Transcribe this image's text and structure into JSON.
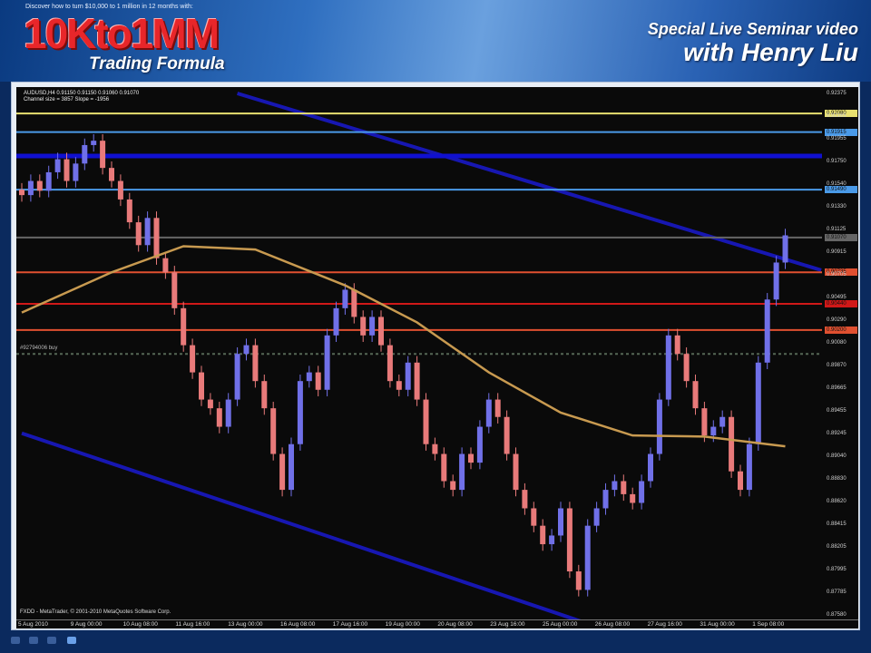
{
  "banner": {
    "tagline": "Discover how to turn $10,000 to 1 million in 12 months with:",
    "logo": "10Kto1MM",
    "logo_sub": "Trading Formula",
    "seminar_line1": "Special Live Seminar video",
    "seminar_line2": "with Henry Liu"
  },
  "chart_info": {
    "symbol_line": "AUDUSD,H4  0.91150 0.91150 0.91060 0.91070",
    "channel_line": "Channel size = 3857  Slope = -1956",
    "order_label": "#92794006 buy",
    "copyright": "FXDD - MetaTrader, © 2001-2010 MetaQuotes Software Corp."
  },
  "colors": {
    "bull": "#7070e8",
    "bear": "#e87a7a",
    "ma": "#c89a50",
    "channel": "#1a1ad0",
    "background": "#0a0a0a"
  },
  "chart_data": {
    "type": "candlestick",
    "title": "AUDUSD,H4",
    "ylim": [
      0.8758,
      0.92375
    ],
    "y_ticks": [
      "0.92375",
      "0.92165",
      "0.91955",
      "0.91750",
      "0.91540",
      "0.91330",
      "0.91125",
      "0.90915",
      "0.90705",
      "0.90495",
      "0.90290",
      "0.90080",
      "0.89870",
      "0.89665",
      "0.89455",
      "0.89245",
      "0.89040",
      "0.88830",
      "0.88620",
      "0.88415",
      "0.88205",
      "0.87995",
      "0.87785",
      "0.87580"
    ],
    "x_ticks": [
      "5 Aug 2010",
      "9 Aug 00:00",
      "10 Aug 08:00",
      "11 Aug 16:00",
      "13 Aug 00:00",
      "16 Aug 08:00",
      "17 Aug 16:00",
      "19 Aug 00:00",
      "20 Aug 08:00",
      "23 Aug 16:00",
      "25 Aug 00:00",
      "26 Aug 08:00",
      "27 Aug 16:00",
      "31 Aug 00:00",
      "1 Sep 08:00"
    ],
    "closes": [
      0.9144,
      0.9157,
      0.9148,
      0.9165,
      0.9177,
      0.9157,
      0.9173,
      0.919,
      0.9194,
      0.9169,
      0.9157,
      0.914,
      0.9119,
      0.9098,
      0.9123,
      0.9086,
      0.9073,
      0.904,
      0.9006,
      0.8981,
      0.8956,
      0.8948,
      0.8931,
      0.8956,
      0.8998,
      0.9006,
      0.8973,
      0.8948,
      0.8906,
      0.8873,
      0.8915,
      0.8973,
      0.8981,
      0.8965,
      0.9015,
      0.904,
      0.9057,
      0.9032,
      0.9015,
      0.9032,
      0.9006,
      0.8973,
      0.8965,
      0.899,
      0.8956,
      0.8915,
      0.8906,
      0.8881,
      0.8873,
      0.8906,
      0.8898,
      0.8931,
      0.8956,
      0.894,
      0.8906,
      0.8873,
      0.8856,
      0.884,
      0.8823,
      0.8831,
      0.8856,
      0.8798,
      0.8781,
      0.884,
      0.8856,
      0.8873,
      0.8881,
      0.8869,
      0.8861,
      0.8881,
      0.8906,
      0.8956,
      0.9015,
      0.8998,
      0.8973,
      0.8948,
      0.8923,
      0.8931,
      0.894,
      0.889,
      0.8873,
      0.8915,
      0.899,
      0.9048,
      0.9082,
      0.9107
    ],
    "moving_average": {
      "name": "MA",
      "points": [
        [
          0,
          0.9036
        ],
        [
          10,
          0.9073
        ],
        [
          18,
          0.9097
        ],
        [
          26,
          0.9094
        ],
        [
          36,
          0.9061
        ],
        [
          44,
          0.9027
        ],
        [
          52,
          0.8981
        ],
        [
          60,
          0.8944
        ],
        [
          68,
          0.8923
        ],
        [
          76,
          0.8922
        ],
        [
          85,
          0.8913
        ]
      ]
    },
    "levels": [
      {
        "price": 0.9219,
        "color": "#e8e070",
        "tag": "0.92080"
      },
      {
        "price": 0.9202,
        "color": "#4a9ae8",
        "tag": "0.91915"
      },
      {
        "price": 0.918,
        "color": "#1010d0",
        "tag": ""
      },
      {
        "price": 0.9149,
        "color": "#4a9ae8",
        "tag": "0.91490"
      },
      {
        "price": 0.9105,
        "color": "#666666",
        "tag": "0.91070"
      },
      {
        "price": 0.9073,
        "color": "#e05030",
        "tag": "0.90735"
      },
      {
        "price": 0.9044,
        "color": "#d01818",
        "tag": "0.90440"
      },
      {
        "price": 0.902,
        "color": "#e05030",
        "tag": "0.90200"
      },
      {
        "price": 0.8998,
        "color": "#556655",
        "tag": "",
        "dashed": true
      }
    ],
    "channel": [
      {
        "from": [
          24,
          0.92375
        ],
        "to": [
          89,
          0.9075
        ]
      },
      {
        "from": [
          0,
          0.8925
        ],
        "to": [
          63,
          0.875
        ]
      }
    ]
  }
}
